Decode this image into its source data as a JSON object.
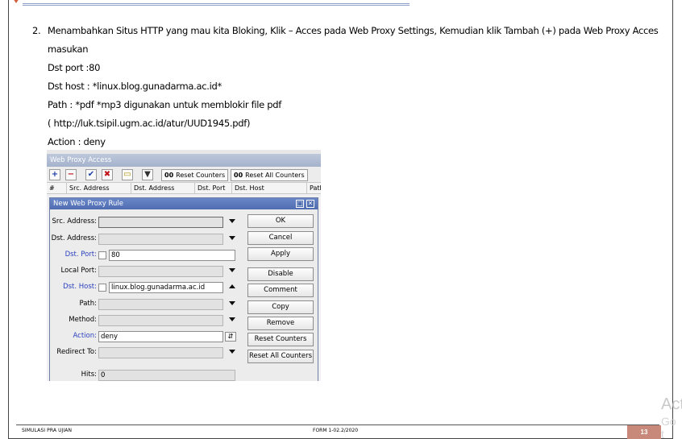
{
  "document": {
    "step_number": "2.",
    "lines": [
      "Menambahkan Situs HTTP yang mau kita Bloking, Klik – Acces pada Web Proxy Settings, Kemudian klik Tambah (+) pada Web Proxy Acces",
      "masukan",
      "Dst port :80",
      "Dst host : *linux.blog.gunadarma.ac.id*",
      "Path : *pdf  *mp3  digunakan untuk memblokir file pdf",
      "( http://luk.tsipil.ugm.ac.id/atur/UUD1945.pdf)",
      "Action : deny"
    ]
  },
  "screenshot": {
    "window_title": "Web Proxy Access",
    "toolbar": {
      "add_icon": "+",
      "remove_icon": "−",
      "enable_icon": "✔",
      "disable_icon": "✖",
      "comment_icon": "▭",
      "filter_icon": "▼",
      "reset_counters_prefix": "00",
      "reset_counters_label": "Reset Counters",
      "reset_all_counters_prefix": "00",
      "reset_all_counters_label": "Reset All Counters"
    },
    "columns": [
      "#",
      "Src. Address",
      "Dst. Address",
      "Dst. Port",
      "Dst. Host",
      "Path"
    ],
    "dialog": {
      "title": "New Web Proxy Rule",
      "fields": {
        "src_address": {
          "label": "Src. Address:",
          "value": ""
        },
        "dst_address": {
          "label": "Dst. Address:",
          "value": ""
        },
        "dst_port": {
          "label": "Dst. Port:",
          "value": "80"
        },
        "local_port": {
          "label": "Local Port:",
          "value": ""
        },
        "dst_host": {
          "label": "Dst. Host:",
          "value": "linux.blog.gunadarma.ac.id"
        },
        "path": {
          "label": "Path:",
          "value": ""
        },
        "method": {
          "label": "Method:",
          "value": ""
        },
        "action": {
          "label": "Action:",
          "value": "deny"
        },
        "redirect_to": {
          "label": "Redirect To:",
          "value": ""
        },
        "hits": {
          "label": "Hits:",
          "value": "0"
        }
      },
      "buttons": {
        "ok": "OK",
        "cancel": "Cancel",
        "apply": "Apply",
        "disable": "Disable",
        "comment": "Comment",
        "copy": "Copy",
        "remove": "Remove",
        "reset_counters": "Reset Counters",
        "reset_all_counters": "Reset All Counters"
      }
    }
  },
  "footer": {
    "left": "SIMULASI PRA UJIAN",
    "center": "FORM 1-02.2/2020",
    "page": "13"
  },
  "watermark": {
    "line1": "Act",
    "line2": "Go t"
  }
}
